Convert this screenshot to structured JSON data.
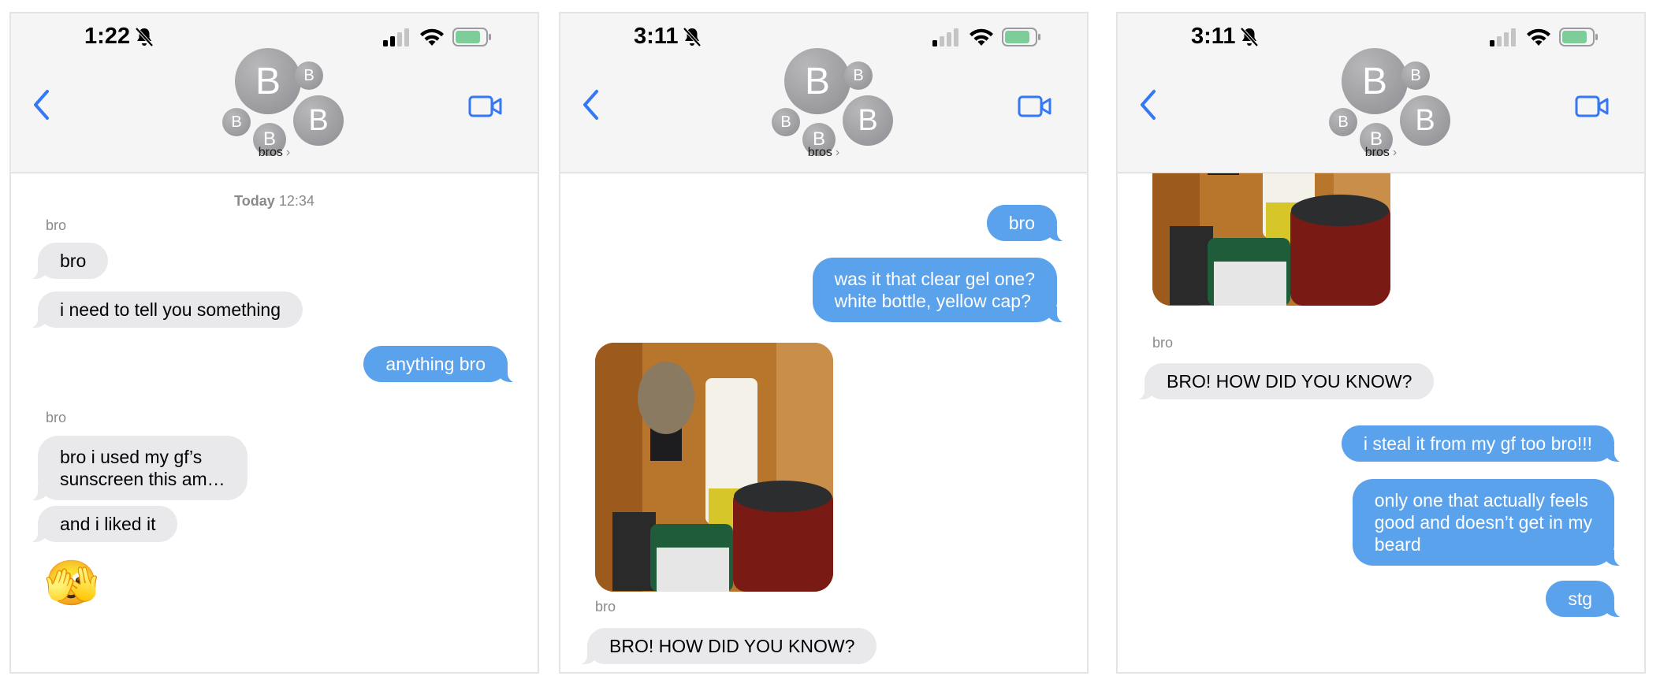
{
  "screens": [
    {
      "time": "1:22",
      "group_name": "bros",
      "avatars": [
        "B",
        "B",
        "B",
        "B",
        "B"
      ],
      "timestamp": {
        "day": "Today",
        "time": "12:34"
      },
      "messages": {
        "sender1": "bro",
        "m1": "bro",
        "m2": "i need to tell you something",
        "m3": "anything bro",
        "sender2": "bro",
        "m4_line1": "bro i used my gf’s",
        "m4_line2": "sunscreen this am…",
        "m5": "and i liked it",
        "emoji": "🫣"
      }
    },
    {
      "time": "3:11",
      "group_name": "bros",
      "avatars": [
        "B",
        "B",
        "B",
        "B",
        "B"
      ],
      "messages": {
        "m1": "bro",
        "m2_line1": "was it that clear gel one?",
        "m2_line2": "white bottle, yellow cap?",
        "sender1": "bro",
        "m3": "BRO! HOW DID YOU KNOW?"
      }
    },
    {
      "time": "3:11",
      "group_name": "bros",
      "avatars": [
        "B",
        "B",
        "B",
        "B",
        "B"
      ],
      "messages": {
        "sender1": "bro",
        "m1": "BRO! HOW DID YOU KNOW?",
        "m2": "i steal it from my gf too bro!!!",
        "m3_line1": "only one that actually feels",
        "m3_line2": "good and doesn’t get in my",
        "m3_line3": "beard",
        "m4": "stg"
      }
    }
  ],
  "colors": {
    "accent": "#3478f6",
    "outgoing_bubble": "#5aa2ec",
    "incoming_bubble": "#e9e9eb",
    "battery": "#7ccd9a"
  },
  "icons": [
    "mute-bell-icon",
    "cellular-signal-icon",
    "wifi-icon",
    "battery-icon",
    "back-chevron-icon",
    "video-camera-icon"
  ]
}
